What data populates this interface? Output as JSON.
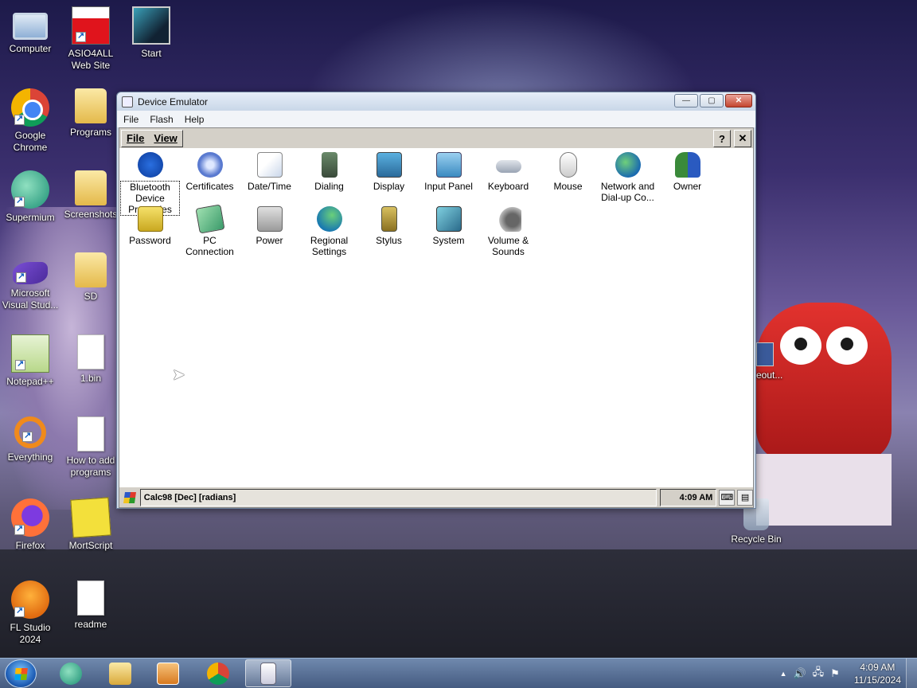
{
  "desktop": {
    "icons": [
      {
        "label": "Computer"
      },
      {
        "label": "ASIO4ALL Web Site"
      },
      {
        "label": "Start"
      },
      {
        "label": "Google Chrome"
      },
      {
        "label": "Programs"
      },
      {
        "label": "Supermium"
      },
      {
        "label": "Screenshots"
      },
      {
        "label": "Microsoft Visual Stud..."
      },
      {
        "label": "SD"
      },
      {
        "label": "Notepad++"
      },
      {
        "label": "1.bin"
      },
      {
        "label": "Everything"
      },
      {
        "label": "How to add programs"
      },
      {
        "label": "Firefox"
      },
      {
        "label": "MortScript"
      },
      {
        "label": "FL Studio 2024"
      },
      {
        "label": "readme"
      },
      {
        "label": "Recycle Bin"
      },
      {
        "label": "eout..."
      }
    ]
  },
  "window": {
    "title": "Device Emulator",
    "menu": [
      "File",
      "Flash",
      "Help"
    ],
    "controls": {
      "minimize": "—",
      "maximize": "▢",
      "close": "✕"
    }
  },
  "device": {
    "toolbar": {
      "menu": [
        "File",
        "View"
      ],
      "help": "?",
      "close": "✕"
    },
    "control_panel_items": [
      {
        "label": "Bluetooth Device Properties",
        "icon": "bluetooth-icon",
        "selected": true
      },
      {
        "label": "Certificates",
        "icon": "certificates-icon"
      },
      {
        "label": "Date/Time",
        "icon": "date-time-icon"
      },
      {
        "label": "Dialing",
        "icon": "dialing-icon"
      },
      {
        "label": "Display",
        "icon": "display-icon"
      },
      {
        "label": "Input Panel",
        "icon": "input-panel-icon"
      },
      {
        "label": "Keyboard",
        "icon": "keyboard-icon"
      },
      {
        "label": "Mouse",
        "icon": "mouse-icon"
      },
      {
        "label": "Network and Dial-up Co...",
        "icon": "network-icon"
      },
      {
        "label": "Owner",
        "icon": "owner-icon"
      },
      {
        "label": "Password",
        "icon": "password-icon"
      },
      {
        "label": "PC Connection",
        "icon": "pc-connection-icon"
      },
      {
        "label": "Power",
        "icon": "power-icon"
      },
      {
        "label": "Regional Settings",
        "icon": "regional-settings-icon"
      },
      {
        "label": "Stylus",
        "icon": "stylus-icon"
      },
      {
        "label": "System",
        "icon": "system-icon"
      },
      {
        "label": "Volume & Sounds",
        "icon": "volume-sounds-icon"
      }
    ],
    "taskbar": {
      "task": "Calc98 [Dec] [radians]",
      "clock": "4:09 AM"
    }
  },
  "taskbar": {
    "clock_time": "4:09 AM",
    "clock_date": "11/15/2024",
    "tray_arrow": "▲"
  }
}
